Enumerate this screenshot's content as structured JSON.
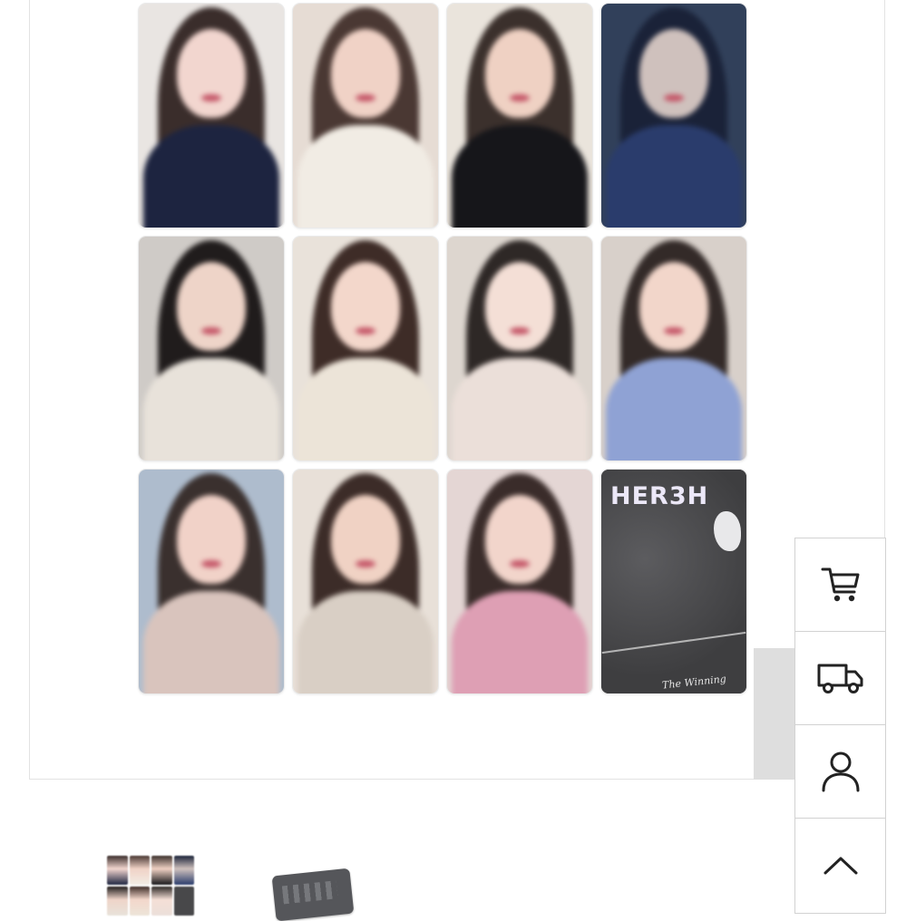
{
  "gallery": {
    "album_card": {
      "title": "HER3H",
      "subtitle": "The Winning"
    },
    "photocards": [
      {
        "bg": "#e9e5e2",
        "hair": "#3a2d2b",
        "skin": "#f2d6cf",
        "top": "#1d2440"
      },
      {
        "bg": "#e6dcd4",
        "hair": "#4a3833",
        "skin": "#f0d2c6",
        "top": "#f1ece4"
      },
      {
        "bg": "#eae4dc",
        "hair": "#3b302c",
        "skin": "#efd1c3",
        "top": "#16161a"
      },
      {
        "bg": "#31405a",
        "hair": "#1a2238",
        "skin": "#cfc1bd",
        "top": "#2a3c6c"
      },
      {
        "bg": "#cfcbc7",
        "hair": "#201c1c",
        "skin": "#eed4c8",
        "top": "#e8e2da"
      },
      {
        "bg": "#e9e2da",
        "hair": "#3e2c27",
        "skin": "#f3d7cb",
        "top": "#ece4d8"
      },
      {
        "bg": "#ddd6cf",
        "hair": "#2e2826",
        "skin": "#f4dfd6",
        "top": "#ebdfd9"
      },
      {
        "bg": "#d8d0ca",
        "hair": "#332a28",
        "skin": "#f2d6ca",
        "top": "#8fa2d4"
      },
      {
        "bg": "#aebccd",
        "hair": "#3a302e",
        "skin": "#f1d2c8",
        "top": "#d9c4bd"
      },
      {
        "bg": "#e8e0d8",
        "hair": "#3c2c28",
        "skin": "#f0d2c4",
        "top": "#d9cfc5"
      },
      {
        "bg": "#e4d6d4",
        "hair": "#3a2c2a",
        "skin": "#f2d5cb",
        "top": "#de9fb4"
      }
    ]
  },
  "floating_nav": {
    "items": [
      {
        "name": "cart-button",
        "icon": "cart-icon"
      },
      {
        "name": "delivery-button",
        "icon": "truck-icon"
      },
      {
        "name": "account-button",
        "icon": "user-icon"
      },
      {
        "name": "scroll-top-button",
        "icon": "chevron-up-icon"
      }
    ]
  },
  "thumbnails": [
    {
      "name": "thumbnail-photocard-set"
    },
    {
      "name": "thumbnail-album-case"
    }
  ]
}
